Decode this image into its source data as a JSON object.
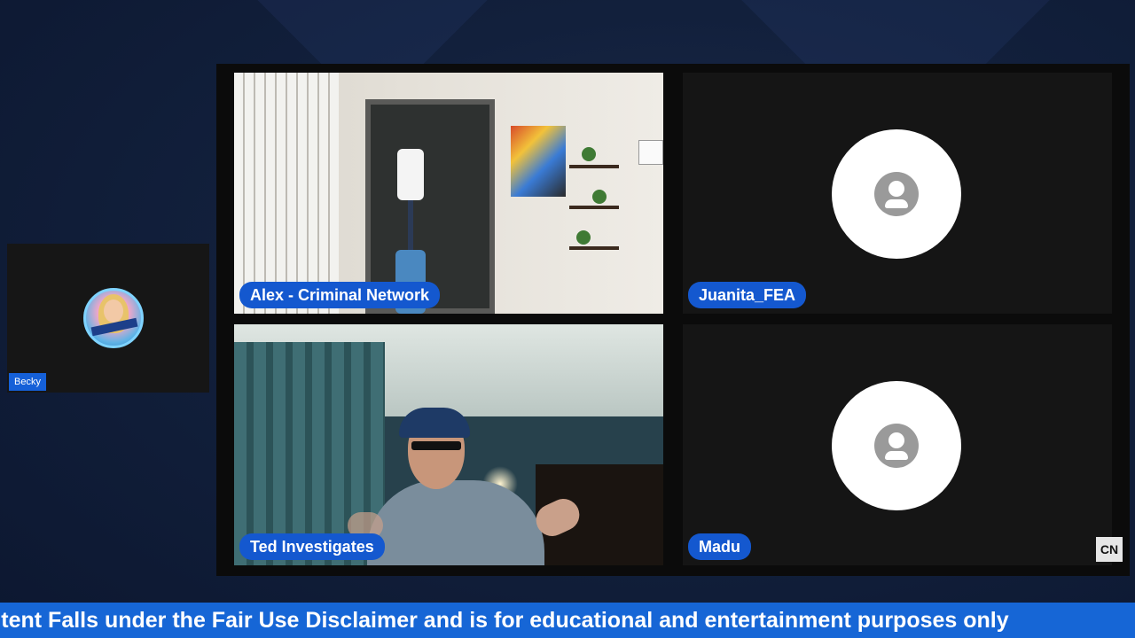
{
  "participants": {
    "side": {
      "name": "Becky"
    },
    "tile1": {
      "name": "Alex - Criminal Network",
      "video": true
    },
    "tile2": {
      "name": "Juanita_FEA",
      "video": false
    },
    "tile3": {
      "name": "Ted Investigates",
      "video": true
    },
    "tile4": {
      "name": "Madu",
      "video": false
    }
  },
  "ticker": {
    "text": "ntent Falls under the Fair Use Disclaimer and is for educational and entertainment purposes only"
  },
  "watermark": {
    "logo_text": "CN"
  },
  "colors": {
    "name_pill": "#1458cf",
    "ticker_bg": "#1666d6",
    "stage_bg": "#0b0b0b",
    "page_bg": "#12203c"
  },
  "icons": {
    "placeholder": "person-silhouette-icon"
  }
}
